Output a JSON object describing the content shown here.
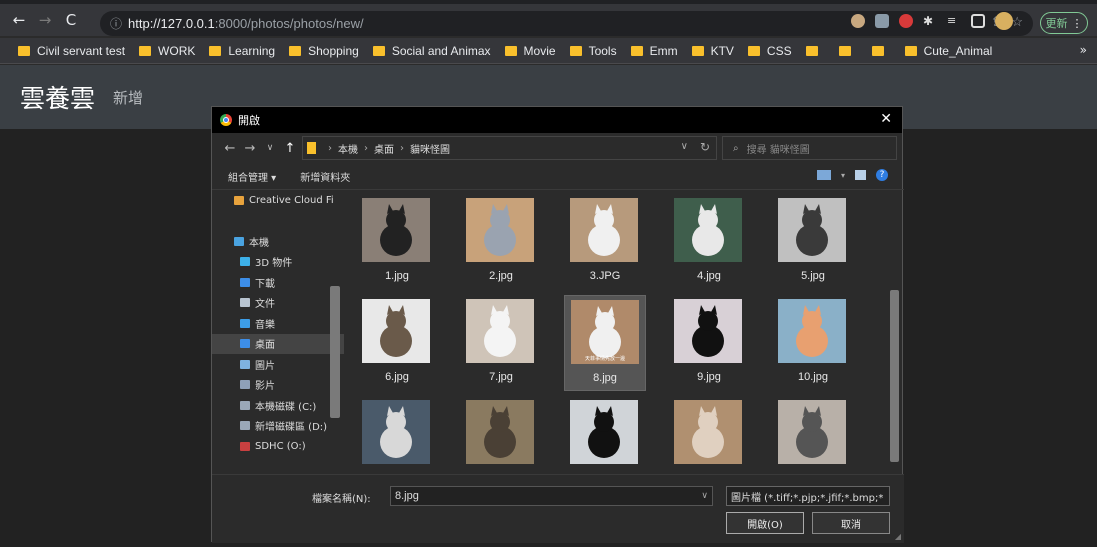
{
  "browser": {
    "url_host": "http://127.0.0.1",
    "url_path": ":8000/photos/photos/new/",
    "update_label": "更新",
    "bookmarks": [
      "Civil servant test",
      "WORK",
      "Learning",
      "Shopping",
      "Social and Animax",
      "Movie",
      "Tools",
      "Emm",
      "KTV",
      "CSS",
      "",
      "",
      "",
      "Cute_Animal"
    ],
    "bookmarks_more": "»"
  },
  "page": {
    "brand": "雲養雲",
    "nav_new": "新增"
  },
  "dialog": {
    "title": "開啟",
    "path": [
      "本機",
      "桌面",
      "貓咪怪圖"
    ],
    "search_placeholder": "搜尋 貓咪怪圖",
    "toolbar": {
      "organize": "組合管理 ▾",
      "new_folder": "新增資料夾"
    },
    "nav_pane": [
      {
        "label": "Creative Cloud Fi",
        "icon": "cloud-folder-icon",
        "color": "#e8a33d",
        "indent": 22,
        "selected": false
      },
      {
        "label": "",
        "icon": "spacer",
        "color": "transparent",
        "indent": 0,
        "selected": false
      },
      {
        "label": "本機",
        "icon": "this-pc-icon",
        "color": "#4aa3e0",
        "indent": 22,
        "selected": false
      },
      {
        "label": "3D 物件",
        "icon": "3d-objects-icon",
        "color": "#3db0e8",
        "indent": 28,
        "selected": false
      },
      {
        "label": "下載",
        "icon": "download-icon",
        "color": "#3d8ee8",
        "indent": 28,
        "selected": false
      },
      {
        "label": "文件",
        "icon": "documents-icon",
        "color": "#b8c4d0",
        "indent": 28,
        "selected": false
      },
      {
        "label": "音樂",
        "icon": "music-icon",
        "color": "#3d9ee8",
        "indent": 28,
        "selected": false
      },
      {
        "label": "桌面",
        "icon": "desktop-icon",
        "color": "#3d8ee8",
        "indent": 28,
        "selected": true
      },
      {
        "label": "圖片",
        "icon": "pictures-icon",
        "color": "#7fb2e0",
        "indent": 28,
        "selected": false
      },
      {
        "label": "影片",
        "icon": "videos-icon",
        "color": "#8ea0b8",
        "indent": 28,
        "selected": false
      },
      {
        "label": "本機磁碟 (C:)",
        "icon": "drive-c-icon",
        "color": "#9aa8b8",
        "indent": 28,
        "selected": false
      },
      {
        "label": "新增磁碟區 (D:)",
        "icon": "drive-d-icon",
        "color": "#9aa8b8",
        "indent": 28,
        "selected": false
      },
      {
        "label": "SDHC (O:)",
        "icon": "sd-card-icon",
        "color": "#c84040",
        "indent": 28,
        "selected": false
      },
      {
        "label": "",
        "icon": "spacer",
        "color": "transparent",
        "indent": 0,
        "selected": false
      },
      {
        "label": "SDHC (O:)",
        "icon": "sd-card-icon",
        "color": "#c84040",
        "indent": 22,
        "selected": false
      }
    ],
    "files": [
      {
        "name": "1.jpg",
        "bg": "#8a7f76",
        "fg": "#222222"
      },
      {
        "name": "2.jpg",
        "bg": "#c8a27a",
        "fg": "#9aa3b0"
      },
      {
        "name": "3.JPG",
        "bg": "#b79a7c",
        "fg": "#f0f0f0"
      },
      {
        "name": "4.jpg",
        "bg": "#3f5e4c",
        "fg": "#e8e8e8"
      },
      {
        "name": "5.jpg",
        "bg": "#c0c0c0",
        "fg": "#3a3a3a"
      },
      {
        "name": "6.jpg",
        "bg": "#e8e8e8",
        "fg": "#6a5a4a"
      },
      {
        "name": "7.jpg",
        "bg": "#cfc4b8",
        "fg": "#f4f4f4"
      },
      {
        "name": "8.jpg",
        "bg": "#b08a6a",
        "fg": "#f0f0f0",
        "selected": true,
        "caption": "天菲事情先放一邊"
      },
      {
        "name": "9.jpg",
        "bg": "#d8d0d6",
        "fg": "#111111"
      },
      {
        "name": "10.jpg",
        "bg": "#8ab0c8",
        "fg": "#e8a070"
      },
      {
        "name": "",
        "bg": "#4a5a6a",
        "fg": "#d8d8d8"
      },
      {
        "name": "",
        "bg": "#8a7a60",
        "fg": "#4a4035"
      },
      {
        "name": "",
        "bg": "#d0d4d8",
        "fg": "#111111"
      },
      {
        "name": "",
        "bg": "#b09070",
        "fg": "#e0d0c0"
      },
      {
        "name": "",
        "bg": "#b8b0a8",
        "fg": "#555555"
      }
    ],
    "filename_label": "檔案名稱(N):",
    "filename_value": "8.jpg",
    "filter_value": "圖片檔 (*.tiff;*.pjp;*.jfif;*.bmp;*",
    "open_label": "開啟(O)",
    "cancel_label": "取消"
  }
}
